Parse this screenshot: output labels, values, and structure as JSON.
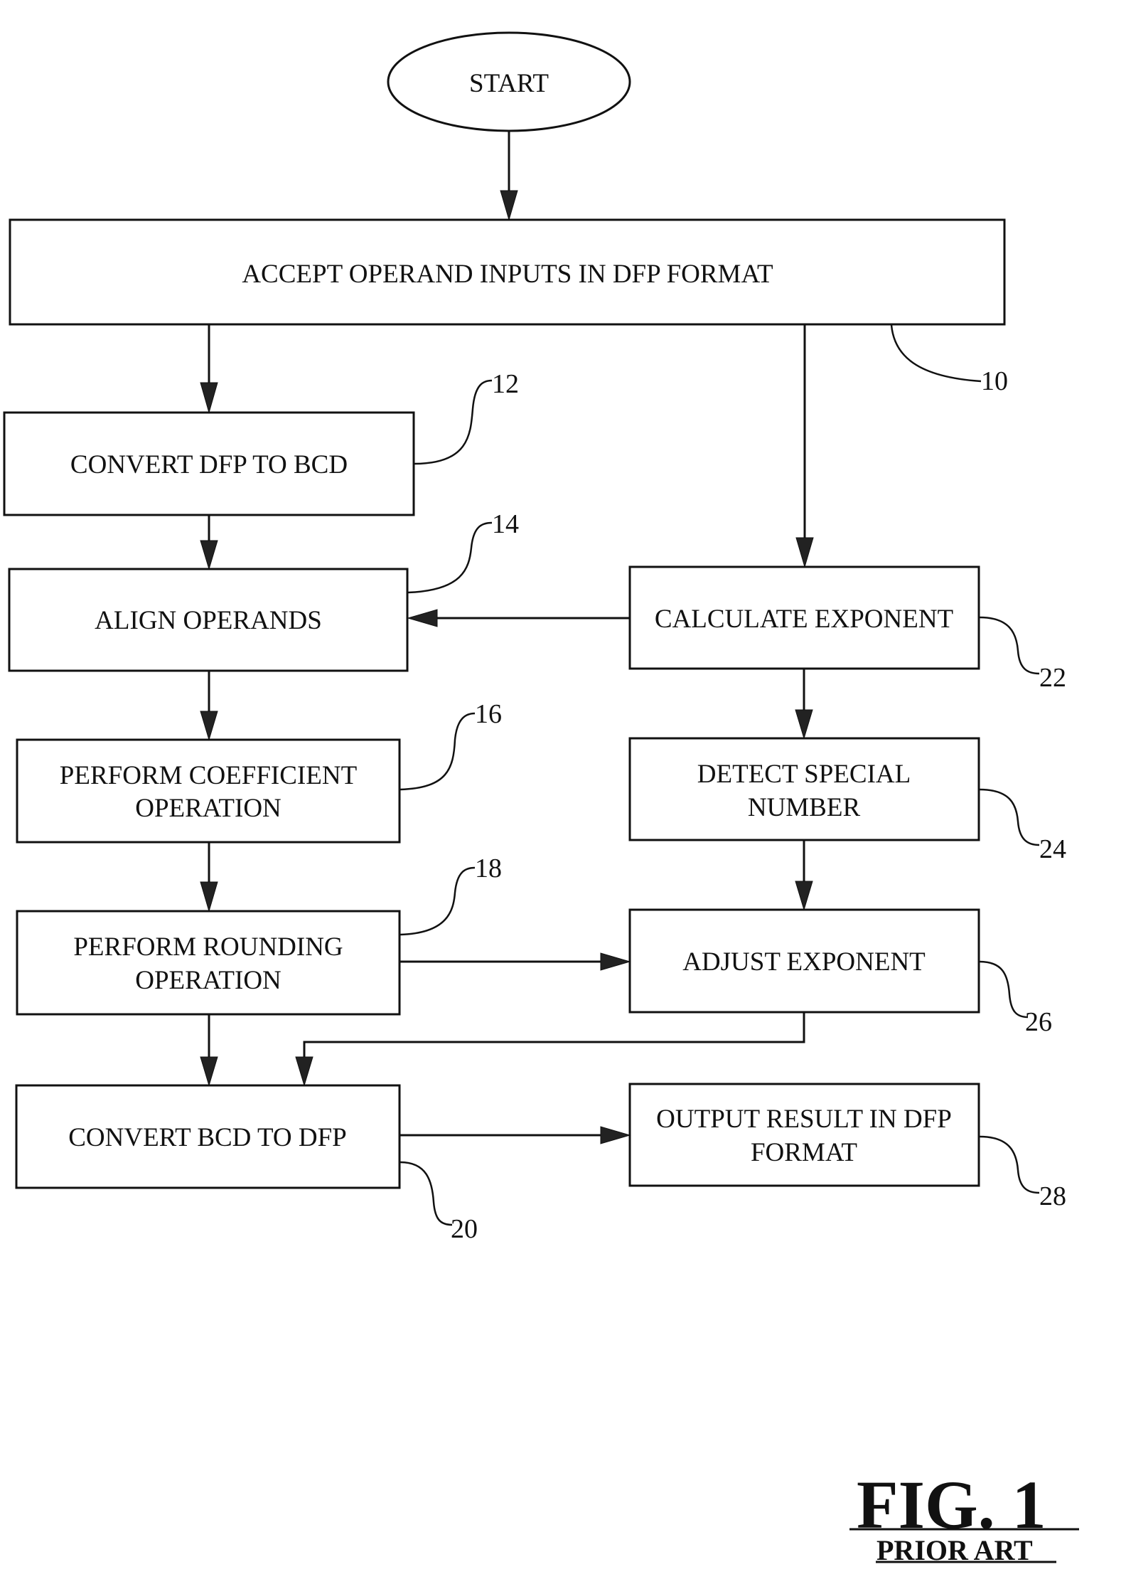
{
  "figure": {
    "title": "FIG. 1",
    "subtitle": "PRIOR ART"
  },
  "start": {
    "label": "START"
  },
  "steps": {
    "s10": {
      "ref": "10",
      "lines": [
        "ACCEPT OPERAND INPUTS IN DFP FORMAT"
      ]
    },
    "s12": {
      "ref": "12",
      "lines": [
        "CONVERT DFP TO BCD"
      ]
    },
    "s14": {
      "ref": "14",
      "lines": [
        "ALIGN OPERANDS"
      ]
    },
    "s16": {
      "ref": "16",
      "lines": [
        "PERFORM COEFFICIENT",
        "OPERATION"
      ]
    },
    "s18": {
      "ref": "18",
      "lines": [
        "PERFORM ROUNDING",
        "OPERATION"
      ]
    },
    "s20": {
      "ref": "20",
      "lines": [
        "CONVERT BCD TO DFP"
      ]
    },
    "s22": {
      "ref": "22",
      "lines": [
        "CALCULATE EXPONENT"
      ]
    },
    "s24": {
      "ref": "24",
      "lines": [
        "DETECT SPECIAL",
        "NUMBER"
      ]
    },
    "s26": {
      "ref": "26",
      "lines": [
        "ADJUST EXPONENT"
      ]
    },
    "s28": {
      "ref": "28",
      "lines": [
        "OUTPUT RESULT IN DFP",
        "FORMAT"
      ]
    }
  },
  "edges": [
    {
      "from": "start",
      "to": "s10"
    },
    {
      "from": "s10",
      "to": "s12"
    },
    {
      "from": "s10",
      "to": "s22"
    },
    {
      "from": "s12",
      "to": "s14"
    },
    {
      "from": "s22",
      "to": "s14"
    },
    {
      "from": "s14",
      "to": "s16"
    },
    {
      "from": "s22",
      "to": "s24"
    },
    {
      "from": "s16",
      "to": "s18"
    },
    {
      "from": "s24",
      "to": "s26"
    },
    {
      "from": "s18",
      "to": "s26"
    },
    {
      "from": "s18",
      "to": "s20"
    },
    {
      "from": "s26",
      "to": "s20"
    },
    {
      "from": "s20",
      "to": "s28"
    }
  ]
}
